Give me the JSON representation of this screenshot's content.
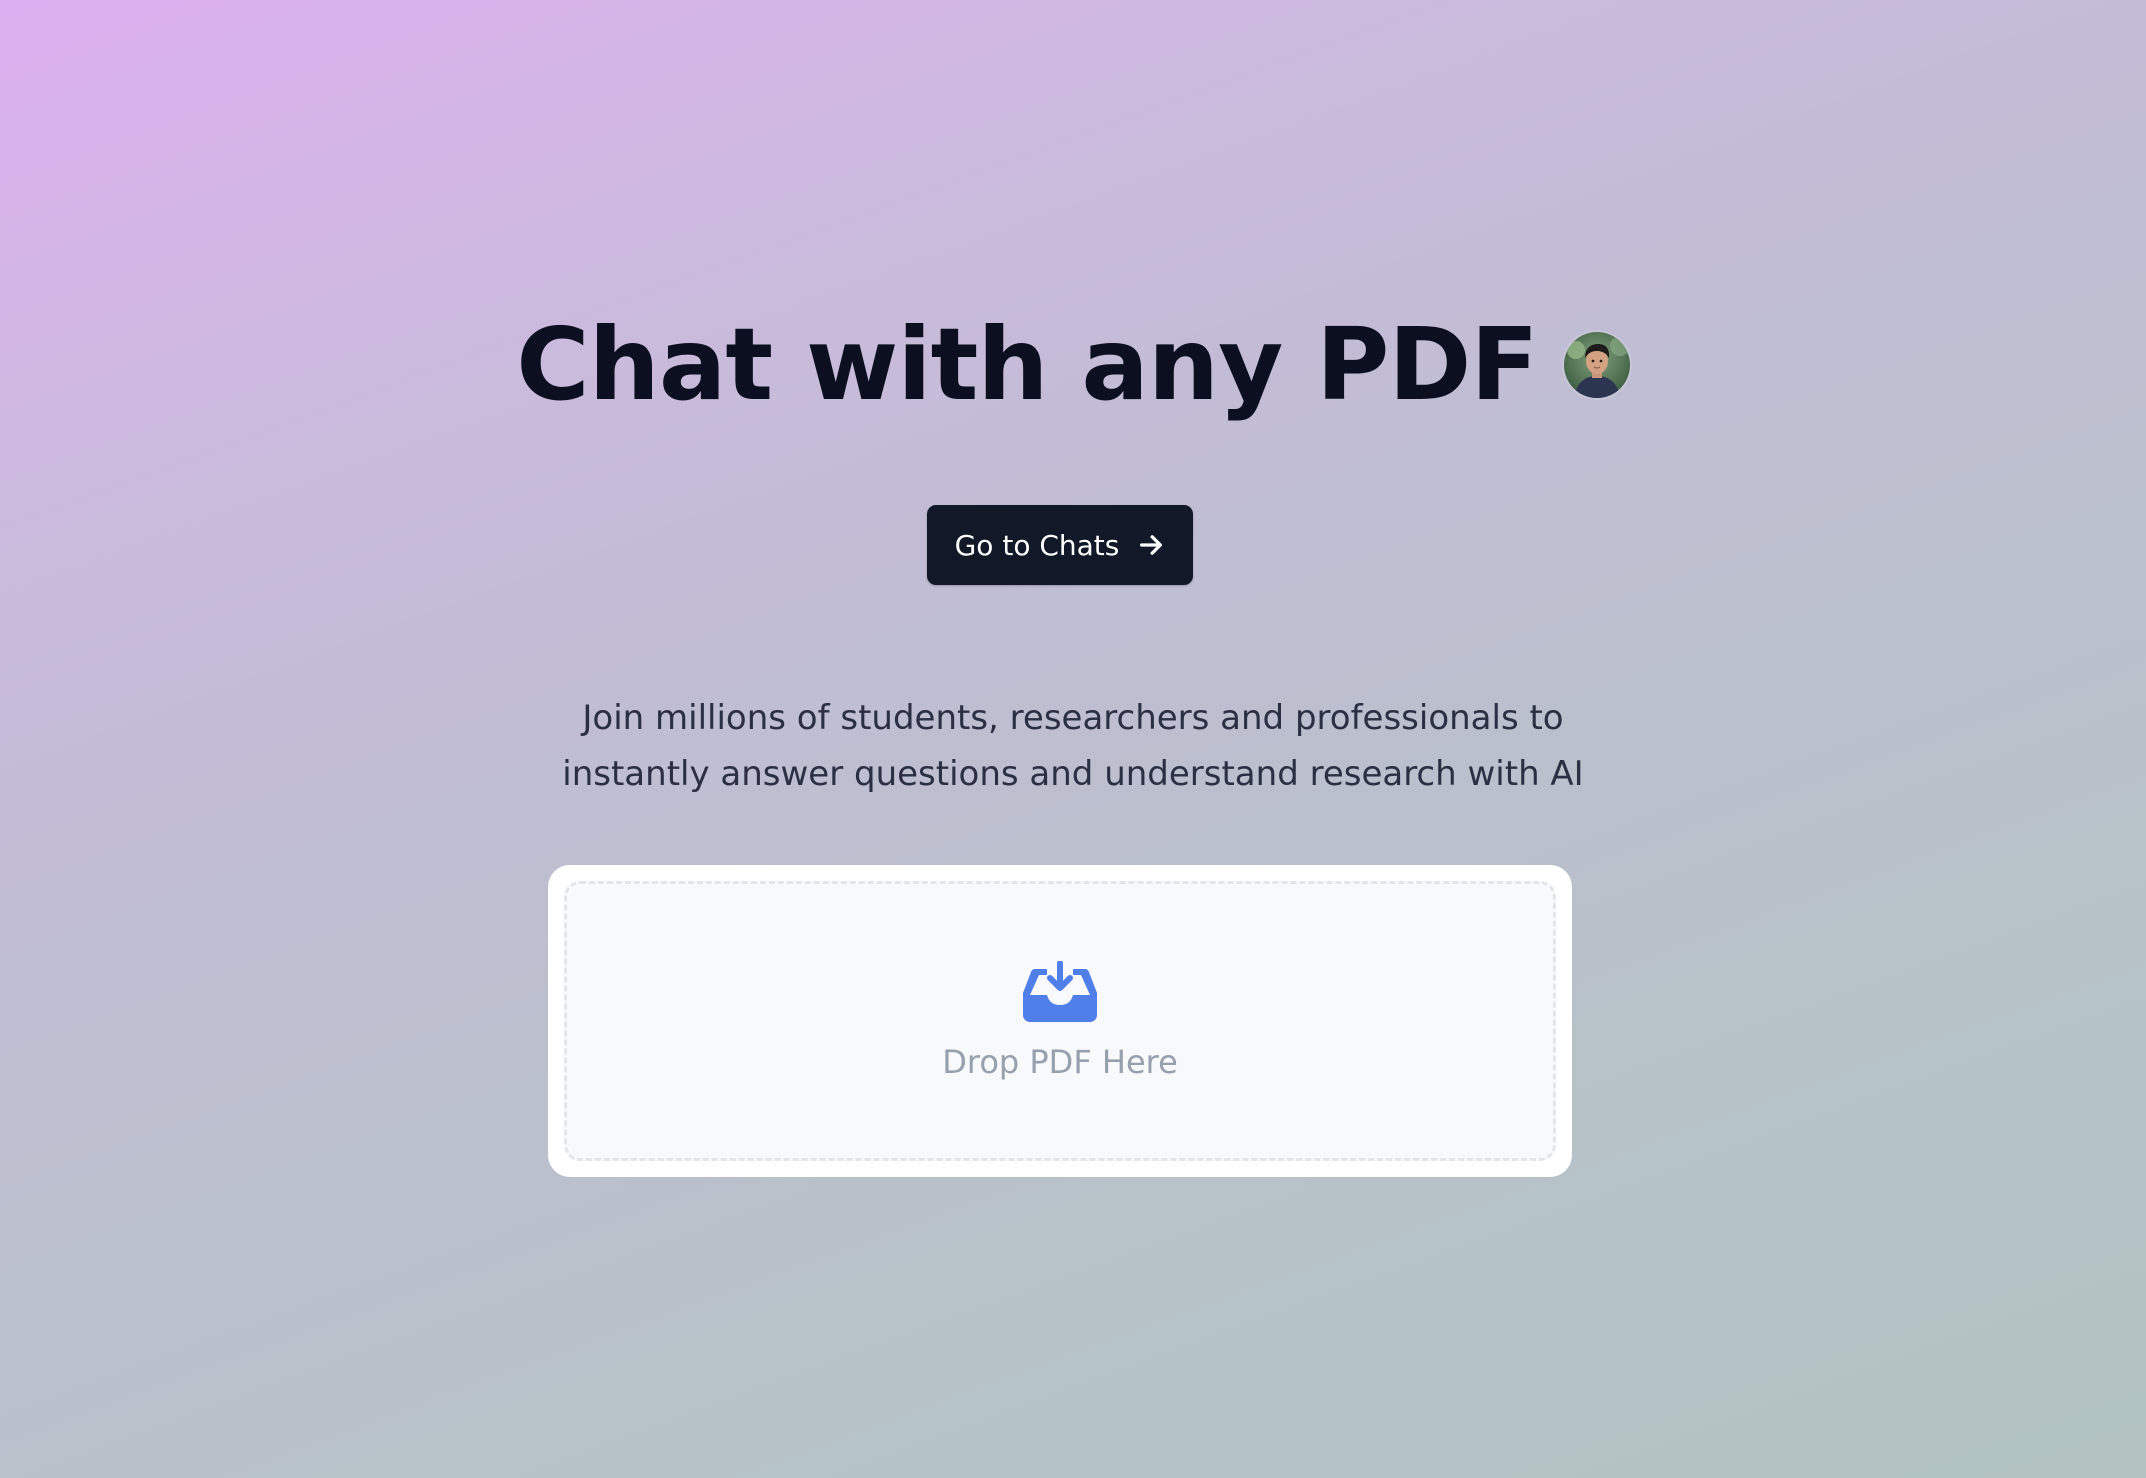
{
  "hero": {
    "title": "Chat with any PDF",
    "cta_label": "Go to Chats",
    "subtitle_line1": "Join millions of students, researchers and professionals to",
    "subtitle_line2": "instantly answer questions and understand research with AI"
  },
  "upload": {
    "label": "Drop PDF Here",
    "icon": "inbox-download-icon"
  },
  "icons": {
    "cta": "arrow-right-icon",
    "avatar": "user-avatar"
  },
  "colors": {
    "gradient_start": "#dcaff0",
    "gradient_end": "#b2c3c2",
    "title": "#0b0f1f",
    "button_bg": "#111827",
    "button_text": "#ffffff",
    "subtitle": "#2a2f43",
    "upload_icon": "#4f7fe8",
    "upload_label": "#96a0ae"
  }
}
